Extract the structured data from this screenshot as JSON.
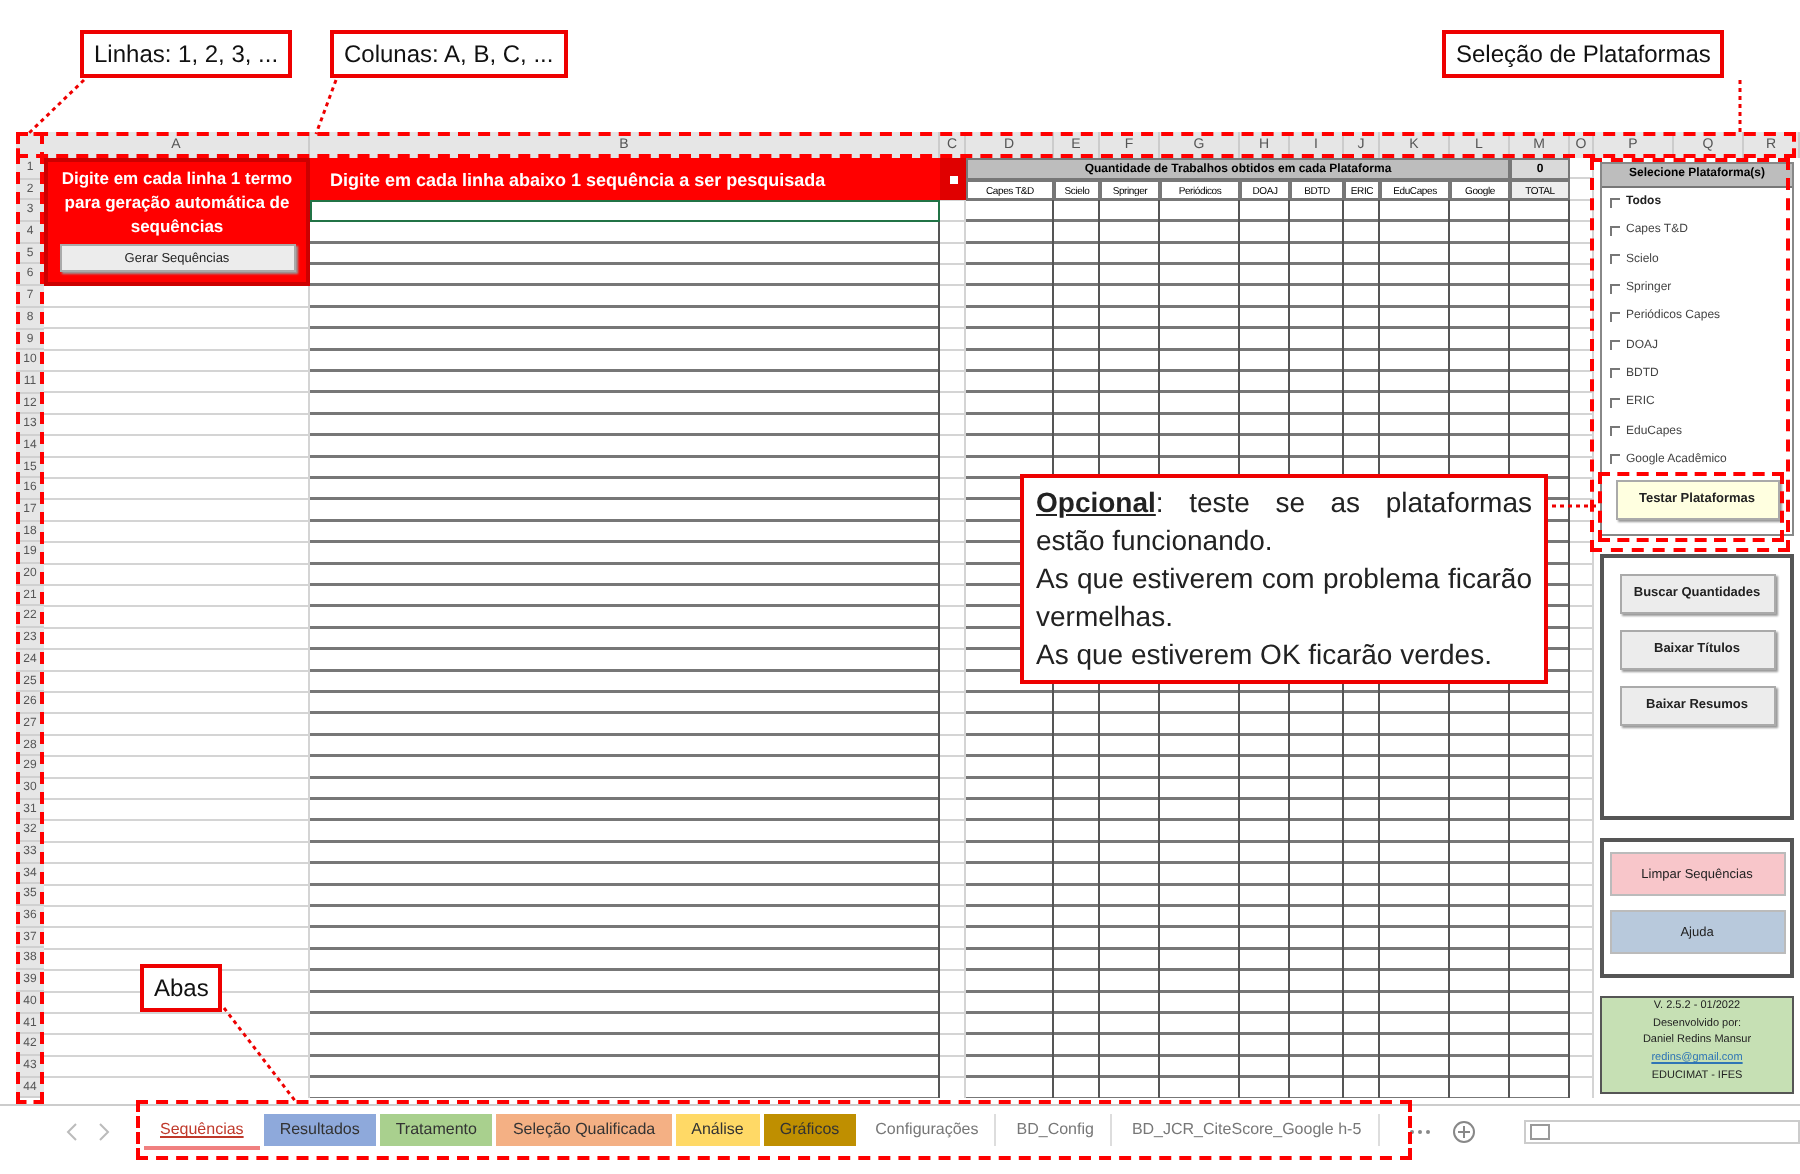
{
  "annotations": {
    "rows": "Linhas: 1, 2, 3, ...",
    "columns": "Colunas: A, B, C, ...",
    "platforms": "Seleção de Plataformas",
    "tabs": "Abas",
    "optional": [
      "**Opcional**: teste se as plataformas estão funcionando.",
      "As que estiverem com problema ficarão vermelhas.",
      "As que estiverem OK ficarão verdes."
    ]
  },
  "sheet": {
    "columns": [
      "A",
      "B",
      "C",
      "D",
      "E",
      "F",
      "G",
      "H",
      "I",
      "J",
      "K",
      "L",
      "M",
      "O",
      "P",
      "Q",
      "R"
    ],
    "row_numbers": [
      "1",
      "2",
      "3",
      "4",
      "5",
      "6",
      "7",
      "8",
      "9",
      "10",
      "11",
      "12",
      "13",
      "14",
      "15",
      "16",
      "17",
      "18",
      "19",
      "20",
      "21",
      "22",
      "23",
      "24",
      "25",
      "26",
      "27",
      "28",
      "29",
      "30",
      "31",
      "32",
      "33",
      "34",
      "35",
      "36",
      "37",
      "38",
      "39",
      "40",
      "41",
      "42",
      "43",
      "44"
    ],
    "term_panel": {
      "instruction": "Digite em cada linha 1 termo para geração automática de sequências",
      "button": "Gerar Sequências"
    },
    "sequences_header": "Digite em cada linha abaixo 1 sequência a ser pesquisada",
    "counts_header": "Quantidade de Trabalhos obtidos em cada Plataforma",
    "total_value": "0",
    "count_columns": [
      "Capes T&D",
      "Scielo",
      "Springer",
      "Periódicos",
      "DOAJ",
      "BDTD",
      "ERIC",
      "EduCapes",
      "Google"
    ],
    "total_column": "TOTAL"
  },
  "platform_panel": {
    "title": "Selecione Plataforma(s)",
    "options": [
      {
        "kind": "all",
        "label": "Todos",
        "checked": false
      },
      {
        "kind": "platform",
        "label": "Capes T&D",
        "checked": false
      },
      {
        "kind": "platform",
        "label": "Scielo",
        "checked": false
      },
      {
        "kind": "platform",
        "label": "Springer",
        "checked": false
      },
      {
        "kind": "platform",
        "label": "Periódicos Capes",
        "checked": false
      },
      {
        "kind": "platform",
        "label": "DOAJ",
        "checked": false
      },
      {
        "kind": "platform",
        "label": "BDTD",
        "checked": false
      },
      {
        "kind": "platform",
        "label": "ERIC",
        "checked": false
      },
      {
        "kind": "platform",
        "label": "EduCapes",
        "checked": false
      },
      {
        "kind": "platform",
        "label": "Google Acadêmico",
        "checked": false
      }
    ],
    "test_button": "Testar Plataformas"
  },
  "actions": [
    "Buscar Quantidades",
    "Baixar Títulos",
    "Baixar Resumos"
  ],
  "utility_buttons": [
    {
      "label": "Limpar Sequências",
      "color": "#f8c6ca"
    },
    {
      "label": "Ajuda",
      "color": "#b8c9dc"
    }
  ],
  "credits": {
    "version": "V. 2.5.2 - 01/2022",
    "developed_by": "Desenvolvido por:",
    "author": "Daniel Redins Mansur",
    "email": "redins@gmail.com",
    "institution": "EDUCIMAT - IFES"
  },
  "tabs": [
    {
      "label": "Sequências",
      "color": "#f08080",
      "selected": true
    },
    {
      "label": "Resultados",
      "color": "#8ea9db",
      "selected": false
    },
    {
      "label": "Tratamento",
      "color": "#a9d08e",
      "selected": false
    },
    {
      "label": "Seleção Qualificada",
      "color": "#f4b084",
      "selected": false
    },
    {
      "label": "Análise",
      "color": "#ffd966",
      "selected": false
    },
    {
      "label": "Gráficos",
      "color": "#bf8f00",
      "selected": false
    },
    {
      "label": "Configurações",
      "selected": false
    },
    {
      "label": "BD_Config",
      "selected": false
    },
    {
      "label": "BD_JCR_CiteScore_Google h-5",
      "selected": false
    }
  ]
}
